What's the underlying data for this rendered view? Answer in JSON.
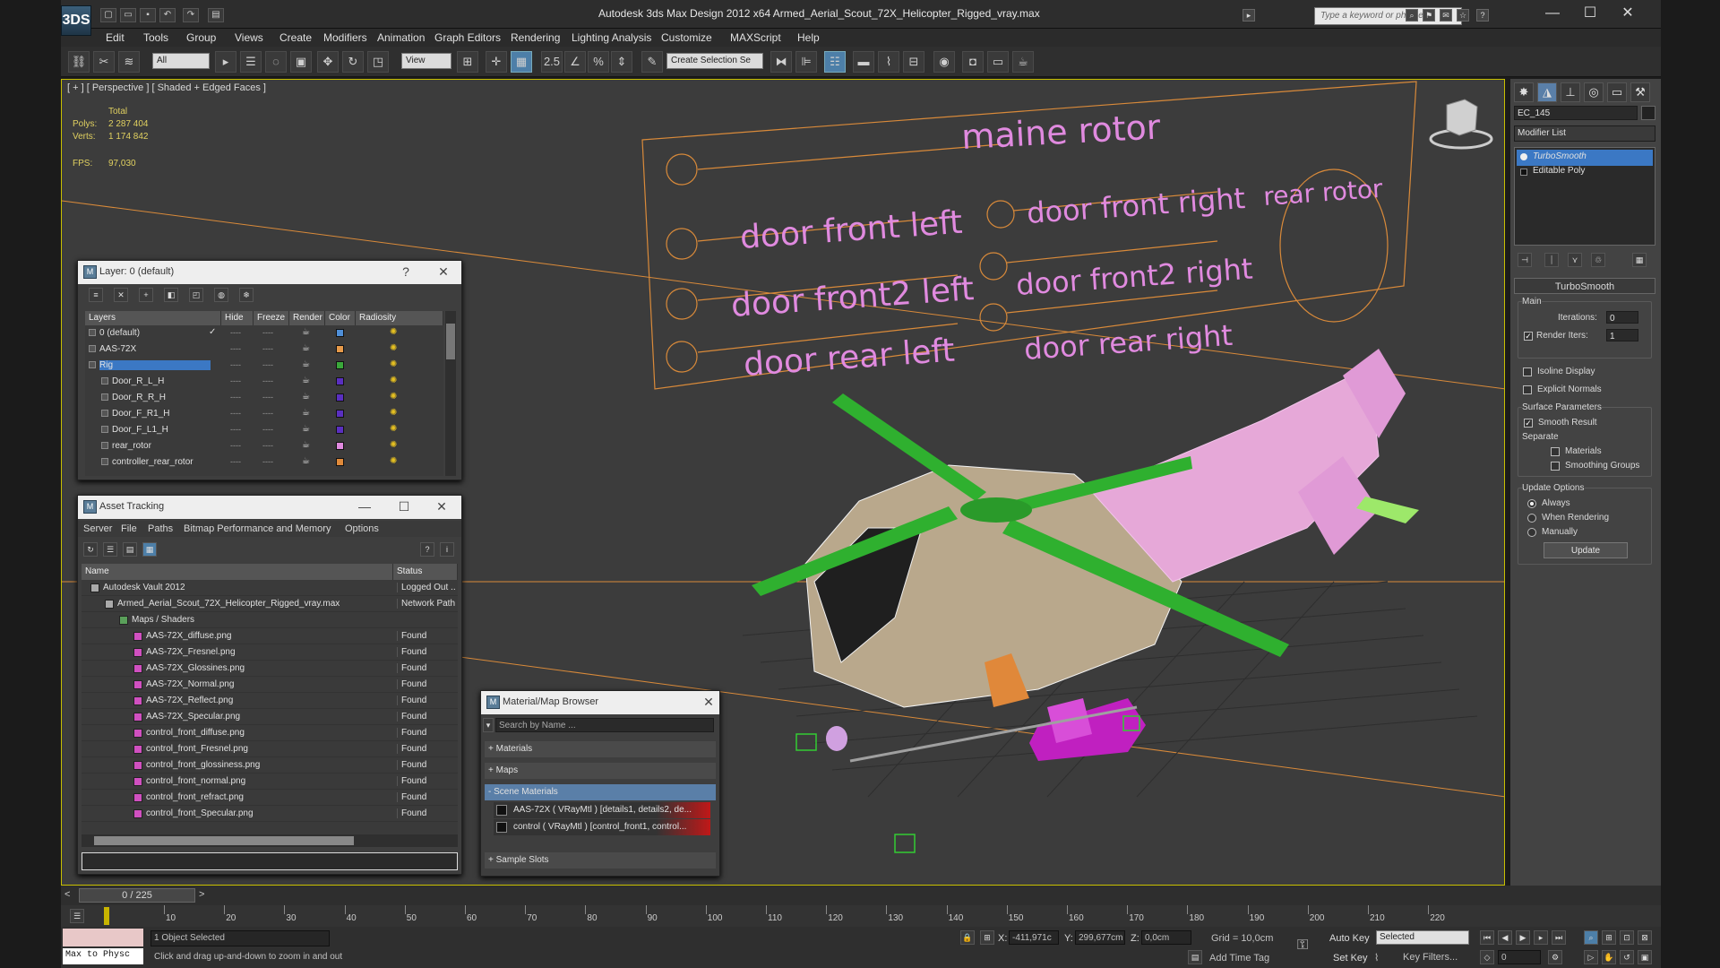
{
  "window": {
    "title": "Autodesk 3ds Max Design 2012 x64      Armed_Aerial_Scout_72X_Helicopter_Rigged_vray.max",
    "app_button": "3DS",
    "search_placeholder": "Type a keyword or phrase",
    "minimize": "—",
    "maximize": "☐",
    "close": "✕"
  },
  "menu": [
    "Edit",
    "Tools",
    "Group",
    "Views",
    "Create",
    "Modifiers",
    "Animation",
    "Graph Editors",
    "Rendering",
    "Lighting Analysis",
    "Customize",
    "MAXScript",
    "Help"
  ],
  "toolbar": {
    "selection_filter": "All",
    "reference_coord": "View",
    "snap_label": "2.5",
    "named_selection": "Create Selection Se"
  },
  "viewport": {
    "label": "[ + ] [ Perspective ] [ Shaded + Edged Faces ]",
    "stats": {
      "total_label": "Total",
      "polys_label": "Polys:",
      "polys": "2 287 404",
      "verts_label": "Verts:",
      "verts": "1 174 842",
      "fps_label": "FPS:",
      "fps": "97,030"
    },
    "board_labels": {
      "main_rotor": "maine rotor",
      "rear_rotor": "rear rotor",
      "door_front_left": "door front left",
      "door_front2_left": "door front2 left",
      "door_rear_left": "door rear left",
      "door_front_right": "door front right",
      "door_front2_right": "door front2 right",
      "door_rear_right": "door rear right"
    }
  },
  "layer_dialog": {
    "title": "Layer: 0 (default)",
    "help": "?",
    "close": "✕",
    "columns": [
      "Layers",
      "Hide",
      "Freeze",
      "Render",
      "Color",
      "Radiosity"
    ],
    "rows": [
      {
        "name": "0 (default)",
        "color": "#4f8fd8",
        "check": "✓",
        "selected": false
      },
      {
        "name": "AAS-72X",
        "color": "#e79a4a",
        "check": "",
        "selected": false
      },
      {
        "name": "Rig",
        "color": "#3aa83a",
        "check": "",
        "selected": true
      },
      {
        "name": "Door_R_L_H",
        "color": "#5a2fc0",
        "check": "",
        "selected": false
      },
      {
        "name": "Door_R_R_H",
        "color": "#5a2fc0",
        "check": "",
        "selected": false
      },
      {
        "name": "Door_F_R1_H",
        "color": "#5a2fc0",
        "check": "",
        "selected": false
      },
      {
        "name": "Door_F_L1_H",
        "color": "#5a2fc0",
        "check": "",
        "selected": false
      },
      {
        "name": "rear_rotor",
        "color": "#e08adf",
        "check": "",
        "selected": false
      },
      {
        "name": "controller_rear_rotor",
        "color": "#e08a3a",
        "check": "",
        "selected": false
      }
    ]
  },
  "asset_dialog": {
    "title": "Asset Tracking",
    "minimize": "—",
    "maximize": "☐",
    "close": "✕",
    "menu": [
      "Server",
      "File",
      "Paths",
      "Bitmap Performance and Memory",
      "Options"
    ],
    "columns": [
      "Name",
      "Status"
    ],
    "rows": [
      {
        "name": "Autodesk Vault 2012",
        "status": "Logged Out ..",
        "indent": 0
      },
      {
        "name": "Armed_Aerial_Scout_72X_Helicopter_Rigged_vray.max",
        "status": "Network Path",
        "indent": 1
      },
      {
        "name": "Maps / Shaders",
        "status": "",
        "indent": 2
      },
      {
        "name": "AAS-72X_diffuse.png",
        "status": "Found",
        "indent": 3
      },
      {
        "name": "AAS-72X_Fresnel.png",
        "status": "Found",
        "indent": 3
      },
      {
        "name": "AAS-72X_Glossines.png",
        "status": "Found",
        "indent": 3
      },
      {
        "name": "AAS-72X_Normal.png",
        "status": "Found",
        "indent": 3
      },
      {
        "name": "AAS-72X_Reflect.png",
        "status": "Found",
        "indent": 3
      },
      {
        "name": "AAS-72X_Specular.png",
        "status": "Found",
        "indent": 3
      },
      {
        "name": "control_front_diffuse.png",
        "status": "Found",
        "indent": 3
      },
      {
        "name": "control_front_Fresnel.png",
        "status": "Found",
        "indent": 3
      },
      {
        "name": "control_front_glossiness.png",
        "status": "Found",
        "indent": 3
      },
      {
        "name": "control_front_normal.png",
        "status": "Found",
        "indent": 3
      },
      {
        "name": "control_front_refract.png",
        "status": "Found",
        "indent": 3
      },
      {
        "name": "control_front_Specular.png",
        "status": "Found",
        "indent": 3
      }
    ]
  },
  "material_browser": {
    "title": "Material/Map Browser",
    "close": "✕",
    "search_placeholder": "Search by Name ...",
    "sections": {
      "materials": "+ Materials",
      "maps": "+ Maps",
      "scene": "- Scene Materials",
      "slots": "+ Sample Slots"
    },
    "scene_items": [
      "AAS-72X  ( VRayMtl )  [details1, details2, de...",
      "control  ( VRayMtl )  [control_front1, control..."
    ]
  },
  "command_panel": {
    "object_name": "EC_145",
    "modifier_list": "Modifier List",
    "stack": [
      "TurboSmooth",
      "Editable Poly"
    ],
    "rollout_title": "TurboSmooth",
    "main_label": "Main",
    "iterations_label": "Iterations:",
    "iterations": "0",
    "render_iters_label": "Render Iters:",
    "render_iters": "1",
    "isoline": "Isoline Display",
    "explicit_normals": "Explicit Normals",
    "surface_label": "Surface Parameters",
    "smooth_result": "Smooth Result",
    "separate_label": "Separate",
    "materials": "Materials",
    "smoothing_groups": "Smoothing Groups",
    "update_options_label": "Update Options",
    "always": "Always",
    "when_rendering": "When Rendering",
    "manually": "Manually",
    "update_button": "Update"
  },
  "timeline": {
    "frame": "0 / 225",
    "prev": "<",
    "next": ">",
    "ticks": [
      "10",
      "20",
      "30",
      "40",
      "50",
      "60",
      "70",
      "80",
      "90",
      "100",
      "110",
      "120",
      "130",
      "140",
      "150",
      "160",
      "170",
      "180",
      "190",
      "200",
      "210",
      "220"
    ]
  },
  "statusbar": {
    "listener": "Max to Physc",
    "selected": "1 Object Selected",
    "prompt": "Click and drag up-and-down to zoom in and out",
    "x_label": "X:",
    "x": "-411,971c",
    "y_label": "Y:",
    "y": "299,677cm",
    "z_label": "Z:",
    "z": "0,0cm",
    "grid": "Grid = 10,0cm",
    "add_time_tag": "Add Time Tag",
    "auto_key": "Auto Key",
    "set_key": "Set Key",
    "key_mode": "Selected",
    "key_filters": "Key Filters...",
    "current_frame": "0"
  }
}
